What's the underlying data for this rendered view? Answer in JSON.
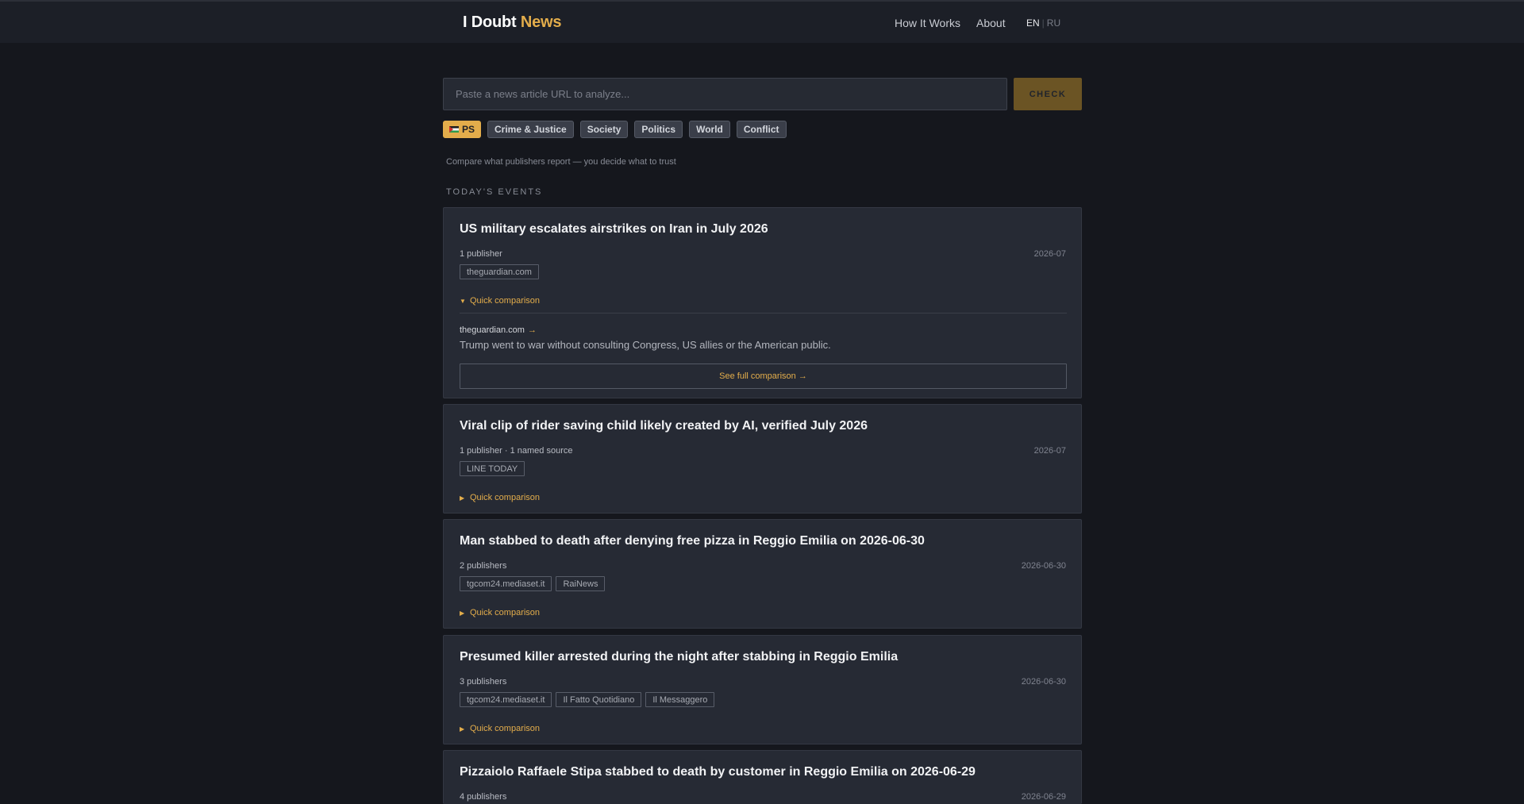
{
  "header": {
    "brand_main": "I Doubt",
    "brand_accent": "News",
    "nav_how": "How It Works",
    "nav_about": "About",
    "lang_en": "EN",
    "lang_sep": "|",
    "lang_ru": "RU"
  },
  "search": {
    "placeholder": "Paste a news article URL to analyze...",
    "value": "",
    "button_label": "CHECK"
  },
  "filters": {
    "ps_label": "PS",
    "categories": [
      "Crime & Justice",
      "Society",
      "Politics",
      "World",
      "Conflict"
    ]
  },
  "tagline": "Compare what publishers report — you decide what to trust",
  "section_label": "TODAY'S EVENTS",
  "quick_comparison_label": "Quick comparison",
  "events": [
    {
      "title": "US military escalates airstrikes on Iran in July 2026",
      "meta": "1 publisher",
      "date": "2026-07",
      "publishers": [
        "theguardian.com"
      ],
      "expanded": true,
      "comparison": {
        "source": "theguardian.com",
        "source_arrow": "→",
        "text": "Trump went to war without consulting Congress, US allies or the American public.",
        "full_button": "See full comparison →"
      }
    },
    {
      "title": "Viral clip of rider saving child likely created by AI, verified July 2026",
      "meta": "1 publisher · 1 named source",
      "date": "2026-07",
      "publishers": [
        "LINE TODAY"
      ],
      "expanded": false
    },
    {
      "title": "Man stabbed to death after denying free pizza in Reggio Emilia on 2026-06-30",
      "meta": "2 publishers",
      "date": "2026-06-30",
      "publishers": [
        "tgcom24.mediaset.it",
        "RaiNews"
      ],
      "expanded": false
    },
    {
      "title": "Presumed killer arrested during the night after stabbing in Reggio Emilia",
      "meta": "3 publishers",
      "date": "2026-06-30",
      "publishers": [
        "tgcom24.mediaset.it",
        "Il Fatto Quotidiano",
        "Il Messaggero"
      ],
      "expanded": false
    },
    {
      "title": "Pizzaiolo Raffaele Stipa stabbed to death by customer in Reggio Emilia on 2026-06-29",
      "meta": "4 publishers",
      "date": "2026-06-29",
      "publishers": [],
      "expanded": false
    }
  ],
  "icons": {
    "expanded_arrow": "▼",
    "collapsed_arrow": "▶"
  },
  "colors": {
    "accent": "#e3ad4b",
    "background": "#15171d",
    "card": "#262a34"
  }
}
